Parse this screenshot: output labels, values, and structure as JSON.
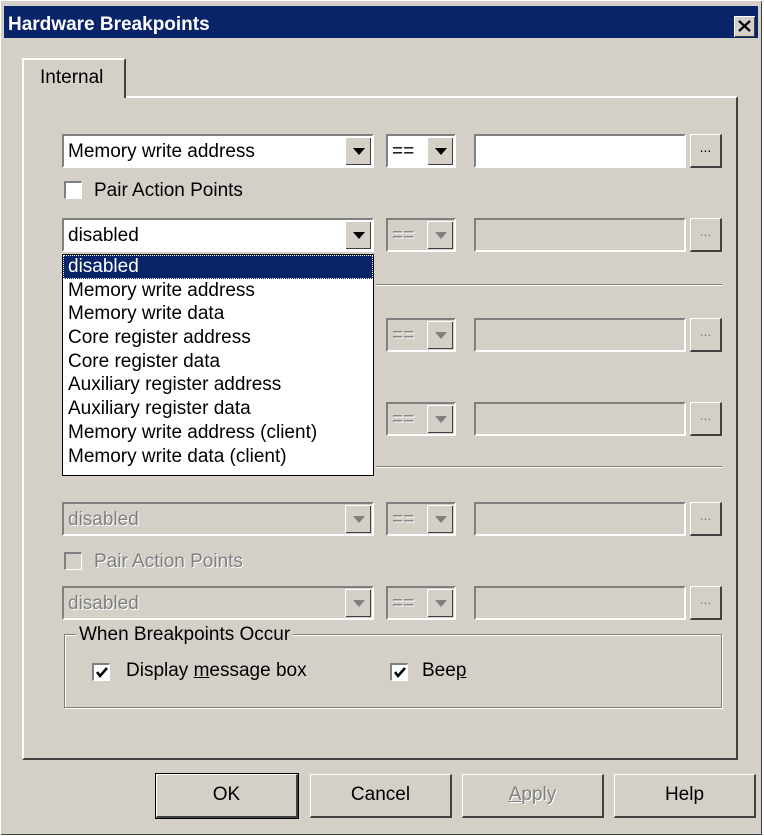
{
  "window": {
    "title": "Hardware Breakpoints",
    "close_glyph": "close-icon"
  },
  "tabs": [
    {
      "label": "Internal",
      "selected": true
    }
  ],
  "row1": {
    "condition": "Memory write address",
    "operator": "==",
    "value": "",
    "browse_label": "..."
  },
  "pair1": {
    "label": "Pair Action Points",
    "checked": false
  },
  "row2": {
    "condition": "disabled",
    "operator": "==",
    "value": "",
    "browse_label": "..."
  },
  "dropdown": {
    "options": [
      "disabled",
      "Memory write address",
      "Memory write data",
      "Core register address",
      "Core register data",
      "Auxiliary register address",
      "Auxiliary register data",
      "Memory write address (client)",
      "Memory write data (client)"
    ],
    "selected": "disabled"
  },
  "row3": {
    "operator": "==",
    "browse_label": "..."
  },
  "row4": {
    "operator": "==",
    "browse_label": "..."
  },
  "row5": {
    "condition": "disabled",
    "operator": "==",
    "browse_label": "..."
  },
  "pair3": {
    "label": "Pair Action Points",
    "checked": false
  },
  "row6": {
    "condition": "disabled",
    "operator": "==",
    "browse_label": "..."
  },
  "group": {
    "title": "When Breakpoints Occur",
    "msgbox": {
      "label_pre": "Display ",
      "label_u": "m",
      "label_post": "essage box",
      "checked": true
    },
    "beep": {
      "label_pre": "Bee",
      "label_u": "p",
      "label_post": "",
      "checked": true
    }
  },
  "buttons": {
    "ok": "OK",
    "cancel": "Cancel",
    "apply_u": "A",
    "apply_rest": "pply",
    "help": "Help"
  }
}
